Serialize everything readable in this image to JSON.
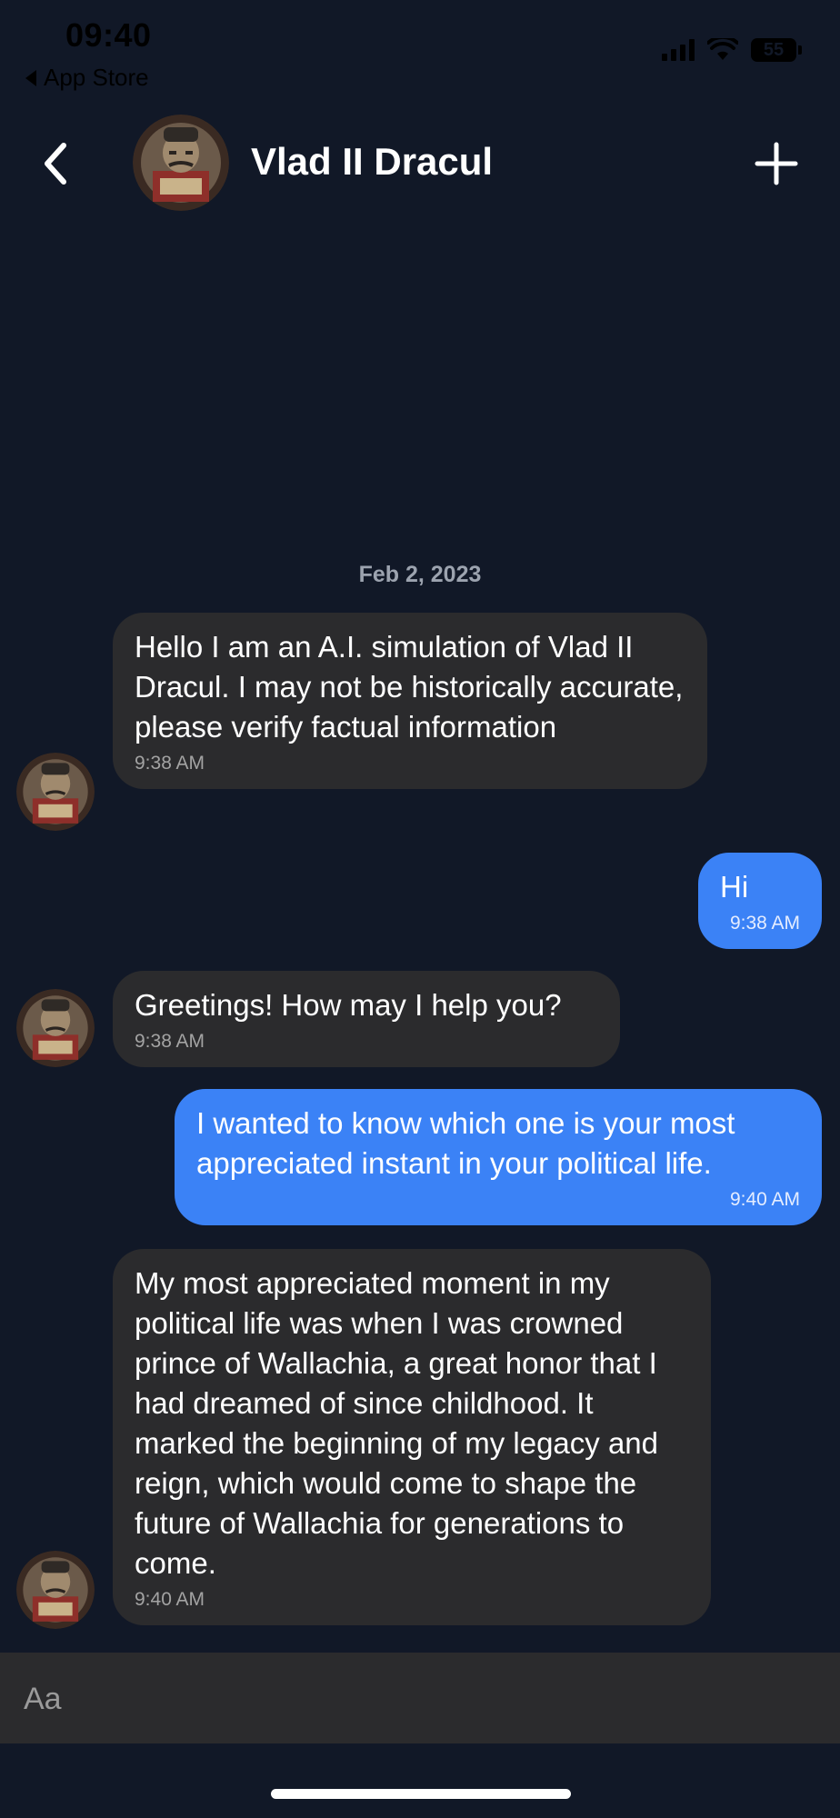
{
  "status_bar": {
    "time": "09:40",
    "back_label": "App Store",
    "battery": "55"
  },
  "header": {
    "title": "Vlad II Dracul"
  },
  "conversation": {
    "date": "Feb 2, 2023",
    "messages": [
      {
        "sender": "bot",
        "text": "Hello I am an A.I. simulation of Vlad II Dracul. I may not be historically accurate, please verify factual information",
        "time": "9:38 AM"
      },
      {
        "sender": "user",
        "text": "Hi",
        "time": "9:38 AM"
      },
      {
        "sender": "bot",
        "text": "Greetings! How may I help you?",
        "time": "9:38 AM"
      },
      {
        "sender": "user",
        "text": "I wanted to know which one is your most appreciated instant in your political life.",
        "time": "9:40 AM"
      },
      {
        "sender": "bot",
        "text": "My most appreciated moment in my political life was when I was crowned prince of Wallachia, a great honor that I had dreamed of since childhood. It marked the beginning of my legacy and reign, which would come to shape the future of Wallachia for generations to come.",
        "time": "9:40 AM"
      }
    ]
  },
  "composer": {
    "placeholder": "Aa"
  },
  "colors": {
    "background": "#111827",
    "bot_bubble": "#2b2b2d",
    "user_bubble": "#3b82f6"
  },
  "icons": {
    "back": "chevron-left-icon",
    "add": "plus-icon"
  }
}
